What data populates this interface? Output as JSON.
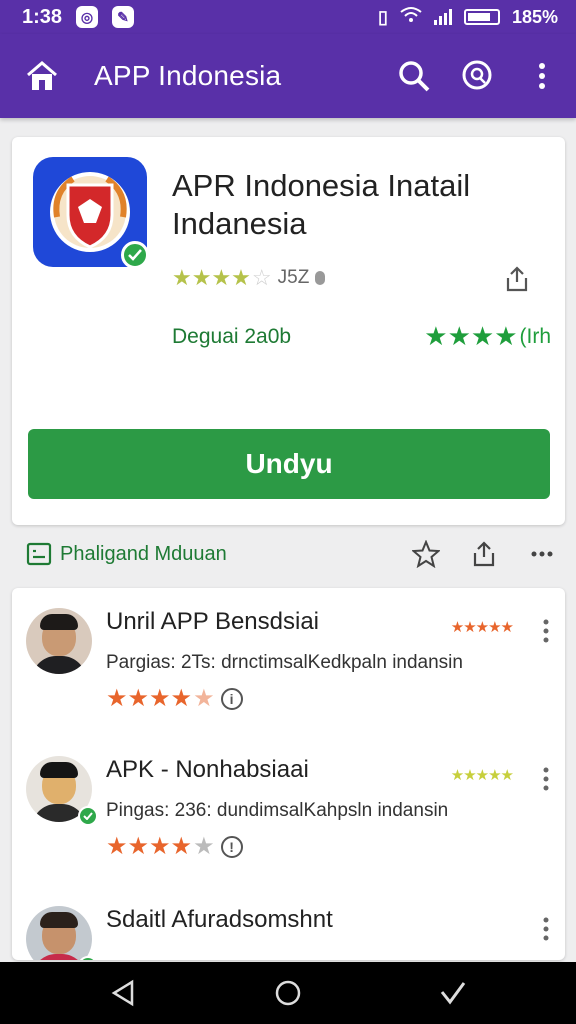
{
  "status_bar": {
    "time": "1:38",
    "battery": "185%"
  },
  "app_bar": {
    "title": "APP Indonesia"
  },
  "app": {
    "title": "APR Indonesia Inatail Indanesia",
    "rating_count": "J5Z",
    "rating_stars": 4,
    "developer": "Deguai 2a0b",
    "green_rating_text": "(Irh",
    "install_label": "Undyu"
  },
  "strip": {
    "link_label": "Phaligand Mduuan"
  },
  "list": [
    {
      "title": "Unril APP Bensdsiai",
      "description": "Pargias: 2Ts: drnctimsalKedkpaln indansin",
      "stars": 4.5,
      "mini_star_color": "#e8652c"
    },
    {
      "title": "APK - Nonhabsiaai",
      "description": "Pingas: 236: dundimsalKahpsln indansin",
      "stars": 4,
      "mini_star_color": "#c7cf3c"
    },
    {
      "title": "Sdaitl Afuradsomshnt",
      "description": "",
      "stars": 0,
      "mini_star_color": ""
    }
  ],
  "colors": {
    "primary": "#5930a8",
    "install_green": "#2c9a45",
    "star_orange": "#e8652c"
  }
}
